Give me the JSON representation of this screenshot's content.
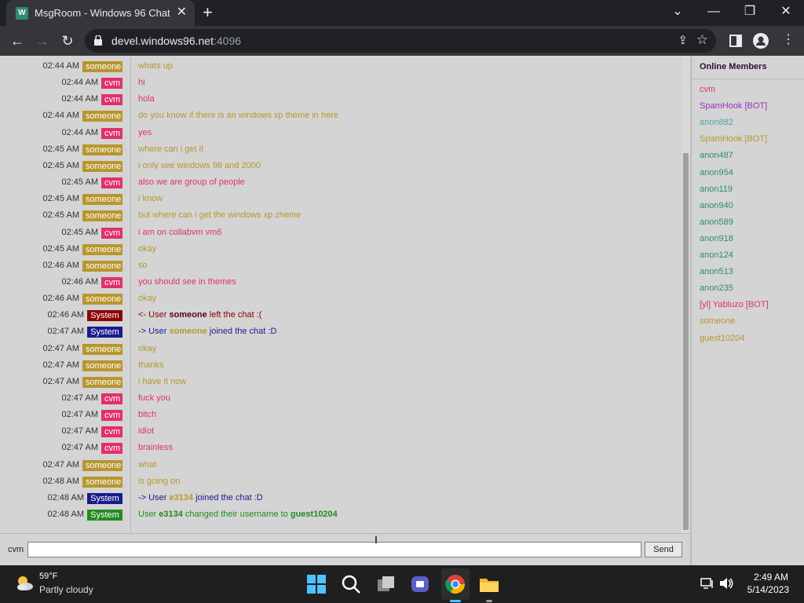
{
  "browser": {
    "tab_title": "MsgRoom - Windows 96 Chat",
    "url_host": "devel.windows96.net",
    "url_port": ":4096"
  },
  "colors": {
    "someone": "#b8962e",
    "cvm": "#e0306e",
    "system_red": "#8b0000",
    "system_blue": "#1a1a8c",
    "system_green": "#228b22",
    "anon_green": "#2e8b6a",
    "spamhook_purple": "#9b30c0"
  },
  "messages": [
    {
      "time": "02:44 AM",
      "user": "someone",
      "role": "someone",
      "text": "whats up"
    },
    {
      "time": "02:44 AM",
      "user": "cvm",
      "role": "cvm",
      "text": "hi"
    },
    {
      "time": "02:44 AM",
      "user": "cvm",
      "role": "cvm",
      "text": "hola"
    },
    {
      "time": "02:44 AM",
      "user": "someone",
      "role": "someone",
      "text": "do you know if there is an windows xp theme in here"
    },
    {
      "time": "02:44 AM",
      "user": "cvm",
      "role": "cvm",
      "text": "yes"
    },
    {
      "time": "02:45 AM",
      "user": "someone",
      "role": "someone",
      "text": "where can i get it"
    },
    {
      "time": "02:45 AM",
      "user": "someone",
      "role": "someone",
      "text": "i only see windows 98 and 2000"
    },
    {
      "time": "02:45 AM",
      "user": "cvm",
      "role": "cvm",
      "text": "also we are group of people"
    },
    {
      "time": "02:45 AM",
      "user": "someone",
      "role": "someone",
      "text": "i know"
    },
    {
      "time": "02:45 AM",
      "user": "someone",
      "role": "someone",
      "text": "but where can i get the windows xp zheme"
    },
    {
      "time": "02:45 AM",
      "user": "cvm",
      "role": "cvm",
      "text": "i am on collabvm vm6"
    },
    {
      "time": "02:45 AM",
      "user": "someone",
      "role": "someone",
      "text": "okay"
    },
    {
      "time": "02:46 AM",
      "user": "someone",
      "role": "someone",
      "text": "so"
    },
    {
      "time": "02:46 AM",
      "user": "cvm",
      "role": "cvm",
      "text": "you should see in themes"
    },
    {
      "time": "02:46 AM",
      "user": "someone",
      "role": "someone",
      "text": "okay"
    },
    {
      "time": "02:46 AM",
      "user": "System",
      "role": "system_red",
      "pre": "<- User ",
      "name": "someone",
      "post": " left the chat :("
    },
    {
      "time": "02:47 AM",
      "user": "System",
      "role": "system_blue",
      "pre": "-> User ",
      "name": "someone",
      "post": " joined the chat :D"
    },
    {
      "time": "02:47 AM",
      "user": "someone",
      "role": "someone",
      "text": "okay"
    },
    {
      "time": "02:47 AM",
      "user": "someone",
      "role": "someone",
      "text": "thanks"
    },
    {
      "time": "02:47 AM",
      "user": "someone",
      "role": "someone",
      "text": "i have it now"
    },
    {
      "time": "02:47 AM",
      "user": "cvm",
      "role": "cvm",
      "text": "fuck you"
    },
    {
      "time": "02:47 AM",
      "user": "cvm",
      "role": "cvm",
      "text": "bitch"
    },
    {
      "time": "02:47 AM",
      "user": "cvm",
      "role": "cvm",
      "text": "idiot"
    },
    {
      "time": "02:47 AM",
      "user": "cvm",
      "role": "cvm",
      "text": "brainless"
    },
    {
      "time": "02:47 AM",
      "user": "someone",
      "role": "someone",
      "text": "what"
    },
    {
      "time": "02:48 AM",
      "user": "someone",
      "role": "someone",
      "text": "is going on"
    },
    {
      "time": "02:48 AM",
      "user": "System",
      "role": "system_blue",
      "pre": "-> User ",
      "name": "e3134",
      "post": " joined the chat :D"
    },
    {
      "time": "02:48 AM",
      "user": "System",
      "role": "system_green",
      "pre": "User ",
      "name": "e3134",
      "post": " changed their username to ",
      "name2": "guest10204"
    }
  ],
  "input": {
    "username": "cvm",
    "value": "",
    "send_label": "Send"
  },
  "members": {
    "title": "Online Members",
    "list": [
      {
        "name": "cvm",
        "color": "#e0306e"
      },
      {
        "name": "SpamHook [BOT]",
        "color": "#9b30c0"
      },
      {
        "name": "anon882",
        "color": "#4aa8a8"
      },
      {
        "name": "SpamHook [BOT]",
        "color": "#b8962e"
      },
      {
        "name": "anon487",
        "color": "#2e8b6a"
      },
      {
        "name": "anon954",
        "color": "#2e8b6a"
      },
      {
        "name": "anon119",
        "color": "#2e8b6a"
      },
      {
        "name": "anon940",
        "color": "#2e8b6a"
      },
      {
        "name": "anon589",
        "color": "#2e8b6a"
      },
      {
        "name": "anon918",
        "color": "#2e8b6a"
      },
      {
        "name": "anon124",
        "color": "#2e8b6a"
      },
      {
        "name": "anon513",
        "color": "#2e8b6a"
      },
      {
        "name": "anon235",
        "color": "#2e8b6a"
      },
      {
        "name": "[yl] Yabluzo [BOT]",
        "color": "#e0306e"
      },
      {
        "name": "someone",
        "color": "#b8962e"
      },
      {
        "name": "guest10204",
        "color": "#b8962e"
      }
    ]
  },
  "taskbar": {
    "temperature": "59°F",
    "condition": "Partly cloudy",
    "time": "2:49 AM",
    "date": "5/14/2023"
  }
}
